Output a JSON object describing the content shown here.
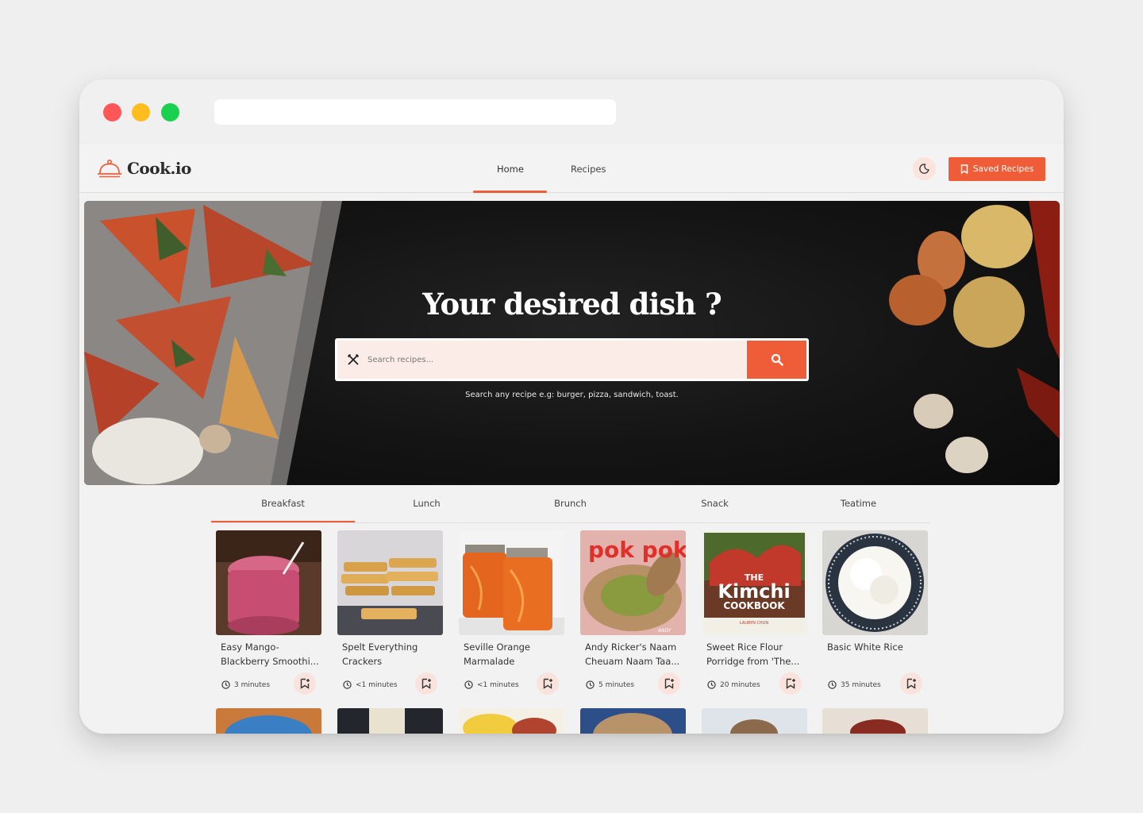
{
  "app": {
    "brand": "Cook.io",
    "accent_color": "#ee5d38"
  },
  "nav": {
    "links": [
      {
        "label": "Home",
        "active": true
      },
      {
        "label": "Recipes",
        "active": false
      }
    ],
    "theme_toggle_icon": "moon-icon",
    "saved_button_label": "Saved Recipes",
    "saved_button_icon": "bookmark-icon"
  },
  "hero": {
    "title": "Your desired dish ?",
    "search_placeholder": "Search recipes...",
    "search_value": "",
    "search_left_icon": "cutlery-icon",
    "search_button_icon": "search-icon",
    "hint": "Search any recipe e.g: burger, pizza, sandwich, toast."
  },
  "tabs": [
    {
      "label": "Breakfast",
      "active": true
    },
    {
      "label": "Lunch",
      "active": false
    },
    {
      "label": "Brunch",
      "active": false
    },
    {
      "label": "Snack",
      "active": false
    },
    {
      "label": "Teatime",
      "active": false
    }
  ],
  "recipes": [
    {
      "title": "Easy Mango-Blackberry Smoothi...",
      "time": "3 minutes"
    },
    {
      "title": "Spelt Everything Crackers",
      "time": "<1 minutes"
    },
    {
      "title": "Seville Orange Marmalade",
      "time": "<1 minutes"
    },
    {
      "title": "Andy Ricker's Naam Cheuam Naam Taa...",
      "time": "5 minutes"
    },
    {
      "title": "Sweet Rice Flour Porridge from 'The...",
      "time": "20 minutes"
    },
    {
      "title": "Basic White Rice",
      "time": "35 minutes"
    }
  ],
  "thumb_text": {
    "pokpok": "pok pok",
    "pokpok_author": "ANDY",
    "kimchi_the": "THE",
    "kimchi_title": "Kimchi",
    "kimchi_sub": "COOKBOOK",
    "kimchi_author": "LAURYN CHUN"
  }
}
